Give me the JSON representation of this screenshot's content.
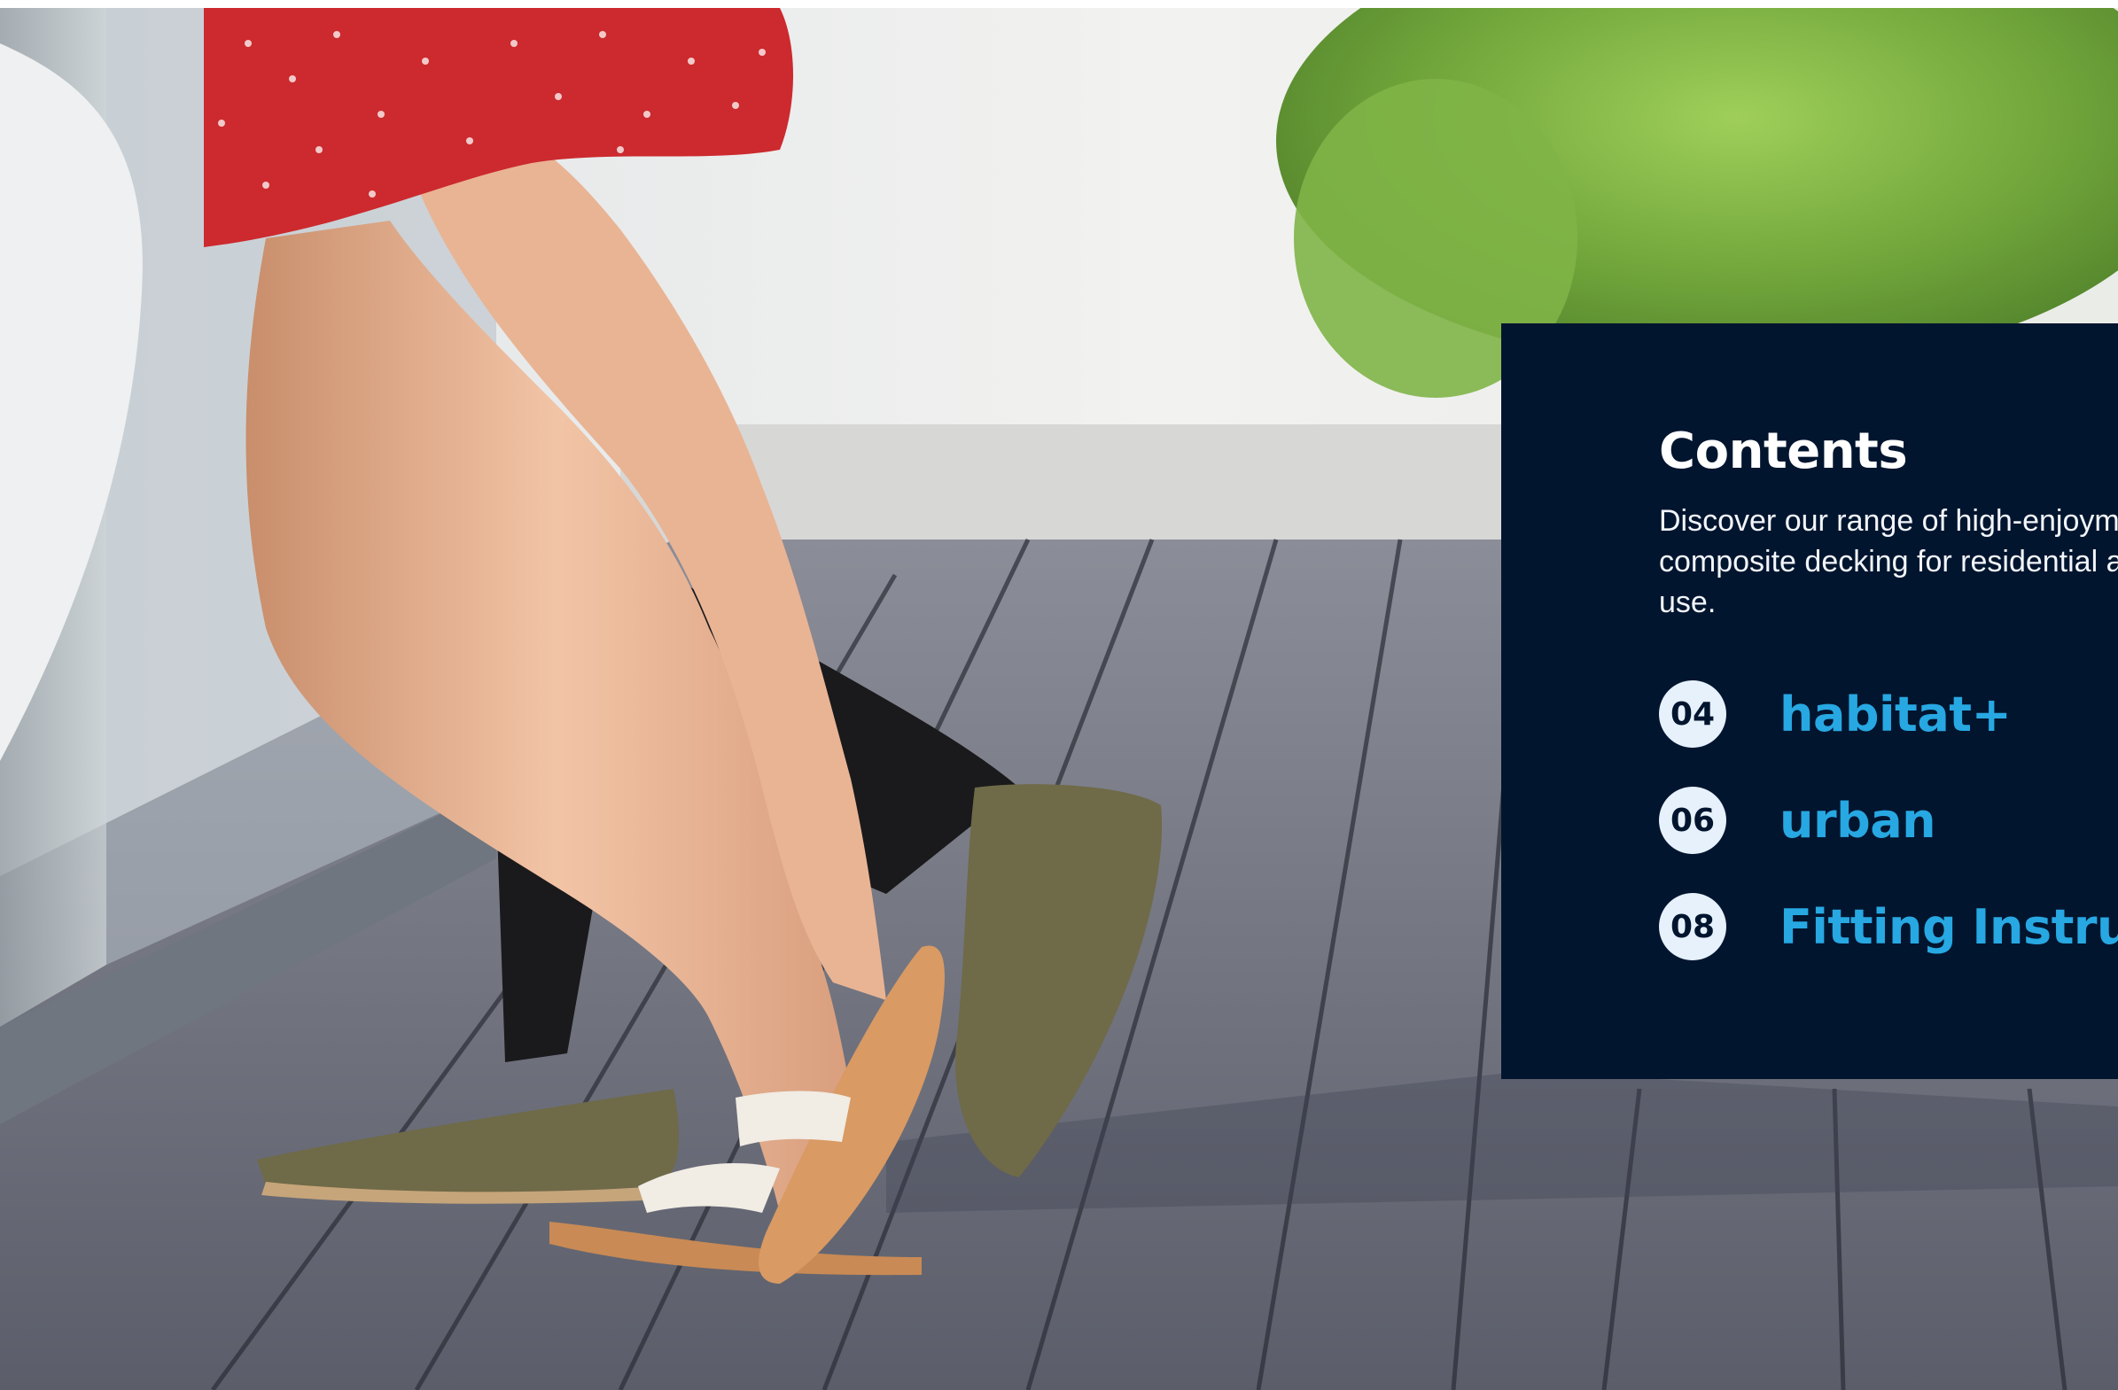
{
  "contents": {
    "title": "Contents",
    "intro": "Discover our range of high-enjoyment, hassle-free composite decking for residential and commercial use.",
    "items": [
      {
        "page": "04",
        "label": "habitat+"
      },
      {
        "page": "06",
        "label": "urban"
      },
      {
        "page": "08",
        "label": "Fitting Instructions"
      }
    ]
  },
  "colors": {
    "panel_background": "#02152f",
    "badge_background": "#e7f1fb",
    "accent": "#27a8e2",
    "text": "#ffffff"
  }
}
